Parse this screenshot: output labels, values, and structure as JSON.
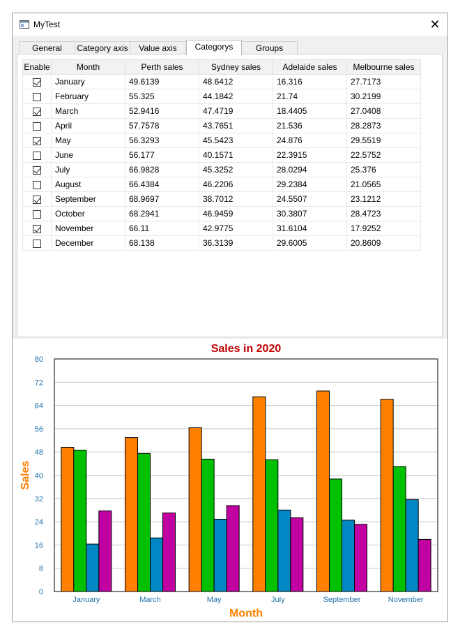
{
  "window": {
    "title": "MyTest",
    "icon": "app-window-icon",
    "close_icon": "close-icon"
  },
  "tabs": [
    {
      "label": "General",
      "active": false
    },
    {
      "label": "Category axis",
      "active": false
    },
    {
      "label": "Value axis",
      "active": false
    },
    {
      "label": "Categorys",
      "active": true
    },
    {
      "label": "Groups",
      "active": false
    }
  ],
  "table": {
    "headers": [
      "Enable",
      "Month",
      "Perth sales",
      "Sydney sales",
      "Adelaide sales",
      "Melbourne sales"
    ],
    "rows": [
      {
        "enabled": true,
        "month": "January",
        "perth": "49.6139",
        "sydney": "48.6412",
        "adelaide": "16.316",
        "melbourne": "27.7173"
      },
      {
        "enabled": false,
        "month": "February",
        "perth": "55.325",
        "sydney": "44.1842",
        "adelaide": "21.74",
        "melbourne": "30.2199"
      },
      {
        "enabled": true,
        "month": "March",
        "perth": "52.9416",
        "sydney": "47.4719",
        "adelaide": "18.4405",
        "melbourne": "27.0408"
      },
      {
        "enabled": false,
        "month": "April",
        "perth": "57.7578",
        "sydney": "43.7651",
        "adelaide": "21.536",
        "melbourne": "28.2873"
      },
      {
        "enabled": true,
        "month": "May",
        "perth": "56.3293",
        "sydney": "45.5423",
        "adelaide": "24.876",
        "melbourne": "29.5519"
      },
      {
        "enabled": false,
        "month": "June",
        "perth": "56.177",
        "sydney": "40.1571",
        "adelaide": "22.3915",
        "melbourne": "22.5752"
      },
      {
        "enabled": true,
        "month": "July",
        "perth": "66.9828",
        "sydney": "45.3252",
        "adelaide": "28.0294",
        "melbourne": "25.376"
      },
      {
        "enabled": false,
        "month": "August",
        "perth": "66.4384",
        "sydney": "46.2206",
        "adelaide": "29.2384",
        "melbourne": "21.0565"
      },
      {
        "enabled": true,
        "month": "September",
        "perth": "68.9697",
        "sydney": "38.7012",
        "adelaide": "24.5507",
        "melbourne": "23.1212"
      },
      {
        "enabled": false,
        "month": "October",
        "perth": "68.2941",
        "sydney": "46.9459",
        "adelaide": "30.3807",
        "melbourne": "28.4723"
      },
      {
        "enabled": true,
        "month": "November",
        "perth": "66.11",
        "sydney": "42.9775",
        "adelaide": "31.6104",
        "melbourne": "17.9252"
      },
      {
        "enabled": false,
        "month": "December",
        "perth": "68.138",
        "sydney": "36.3139",
        "adelaide": "29.6005",
        "melbourne": "20.8609"
      }
    ]
  },
  "chart_data": {
    "type": "bar",
    "title": "Sales in 2020",
    "xlabel": "Month",
    "ylabel": "Sales",
    "ylim": [
      0,
      80
    ],
    "yticks": [
      0,
      8,
      16,
      24,
      32,
      40,
      48,
      56,
      64,
      72,
      80
    ],
    "grid": true,
    "legend": "none",
    "categories": [
      "January",
      "March",
      "May",
      "July",
      "September",
      "November"
    ],
    "series": [
      {
        "key": "perth",
        "color": "#ff8000",
        "values": [
          49.6139,
          52.9416,
          56.3293,
          66.9828,
          68.9697,
          66.11
        ]
      },
      {
        "key": "sydney",
        "color": "#00c000",
        "values": [
          48.6412,
          47.4719,
          45.5423,
          45.3252,
          38.7012,
          42.9775
        ]
      },
      {
        "key": "adelaide",
        "color": "#0087c4",
        "values": [
          16.316,
          18.4405,
          24.876,
          28.0294,
          24.5507,
          31.6104
        ]
      },
      {
        "key": "melbourne",
        "color": "#c000a0",
        "values": [
          27.7173,
          27.0408,
          29.5519,
          25.376,
          23.1212,
          17.9252
        ]
      }
    ],
    "colors": {
      "title": "#c00000",
      "axis_label": "#ff8000",
      "tick_label": "#1c6fa8"
    }
  }
}
